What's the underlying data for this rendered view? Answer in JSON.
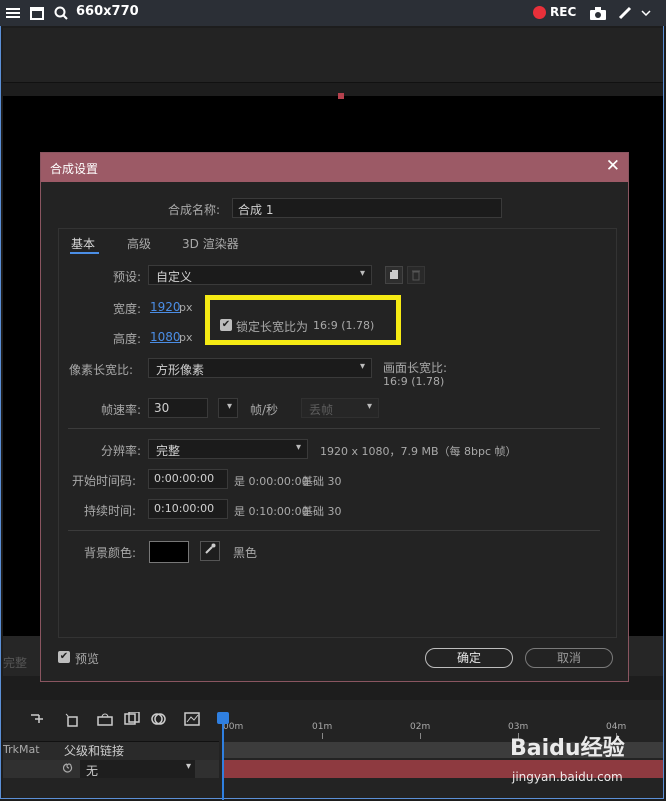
{
  "capture_bar": {
    "size_label": "660x770",
    "rec_label": "REC"
  },
  "app": {
    "done_label": "完整"
  },
  "timeline": {
    "ticks": [
      "00m",
      "01m",
      "02m",
      "03m",
      "04m"
    ],
    "trkmat_label": "TrkMat",
    "parent_label": "父级和链接",
    "parent_value": "无"
  },
  "watermark": {
    "brand": "Baidu经验",
    "url": "jingyan.baidu.com"
  },
  "dialog": {
    "title": "合成设置",
    "comp_name_label": "合成名称:",
    "comp_name_value": "合成 1",
    "tabs": [
      "基本",
      "高级",
      "3D 渲染器"
    ],
    "preset_label": "预设:",
    "preset_value": "自定义",
    "width_label": "宽度:",
    "width_value": "1920",
    "width_unit": "px",
    "height_label": "高度:",
    "height_value": "1080",
    "height_unit": "px",
    "lock_aspect_label": "锁定长宽比为",
    "lock_aspect_value": "16:9 (1.78)",
    "pixel_aspect_label": "像素长宽比:",
    "pixel_aspect_value": "方形像素",
    "frame_aspect_label": "画面长宽比:",
    "frame_aspect_value": "16:9 (1.78)",
    "framerate_label": "帧速率:",
    "framerate_value": "30",
    "framerate_unit": "帧/秒",
    "drop_frame_value": "丢帧",
    "resolution_label": "分辨率:",
    "resolution_value": "完整",
    "resolution_info": "1920 x 1080，7.9 MB（每 8bpc 帧）",
    "start_tc_label": "开始时间码:",
    "start_tc_value": "0:00:00:00",
    "start_tc_info_is": "是 0:00:00:00",
    "start_tc_base": "基础 30",
    "duration_label": "持续时间:",
    "duration_value": "0:10:00:00",
    "duration_info_is": "是 0:10:00:00",
    "duration_base": "基础 30",
    "bg_color_label": "背景颜色:",
    "bg_color_name": "黑色",
    "bg_color_hex": "#000000",
    "preview_label": "预览",
    "ok_label": "确定",
    "cancel_label": "取消"
  },
  "colors": {
    "title_bar": "#9c5a66",
    "accent_blue": "#4b8ee6",
    "highlight_box": "#f5ea14",
    "rec_red": "#e8303a"
  }
}
